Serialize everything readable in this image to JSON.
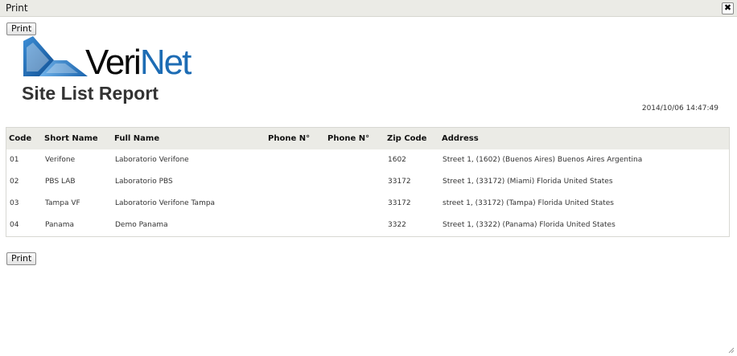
{
  "window": {
    "title": "Print",
    "close_glyph": "✖"
  },
  "toolbar": {
    "print_label_top": "Print",
    "print_label_bottom": "Print"
  },
  "logo": {
    "icon": "verinet-logo-icon",
    "text_part1": "Veri",
    "text_part2": "Net",
    "brand_color": "#1d6cb4"
  },
  "report": {
    "title": "Site List Report",
    "timestamp": "2014/10/06 14:47:49"
  },
  "table": {
    "headers": {
      "code": "Code",
      "short_name": "Short Name",
      "full_name": "Full Name",
      "phone1": "Phone N°",
      "phone2": "Phone N°",
      "zip": "Zip Code",
      "address": "Address"
    },
    "rows": [
      {
        "code": "01",
        "short_name": "Verifone",
        "full_name": "Laboratorio Verifone",
        "phone1": "",
        "phone2": "",
        "zip": "1602",
        "address": "Street 1, (1602) (Buenos Aires) Buenos Aires Argentina"
      },
      {
        "code": "02",
        "short_name": "PBS LAB",
        "full_name": "Laboratorio PBS",
        "phone1": "",
        "phone2": "",
        "zip": "33172",
        "address": "Street 1, (33172) (Miami) Florida United States"
      },
      {
        "code": "03",
        "short_name": "Tampa VF",
        "full_name": "Laboratorio Verifone Tampa",
        "phone1": "",
        "phone2": "",
        "zip": "33172",
        "address": "street 1, (33172) (Tampa) Florida United States"
      },
      {
        "code": "04",
        "short_name": "Panama",
        "full_name": "Demo Panama",
        "phone1": "",
        "phone2": "",
        "zip": "3322",
        "address": "Street 1, (3322) (Panama) Florida United States"
      }
    ]
  }
}
